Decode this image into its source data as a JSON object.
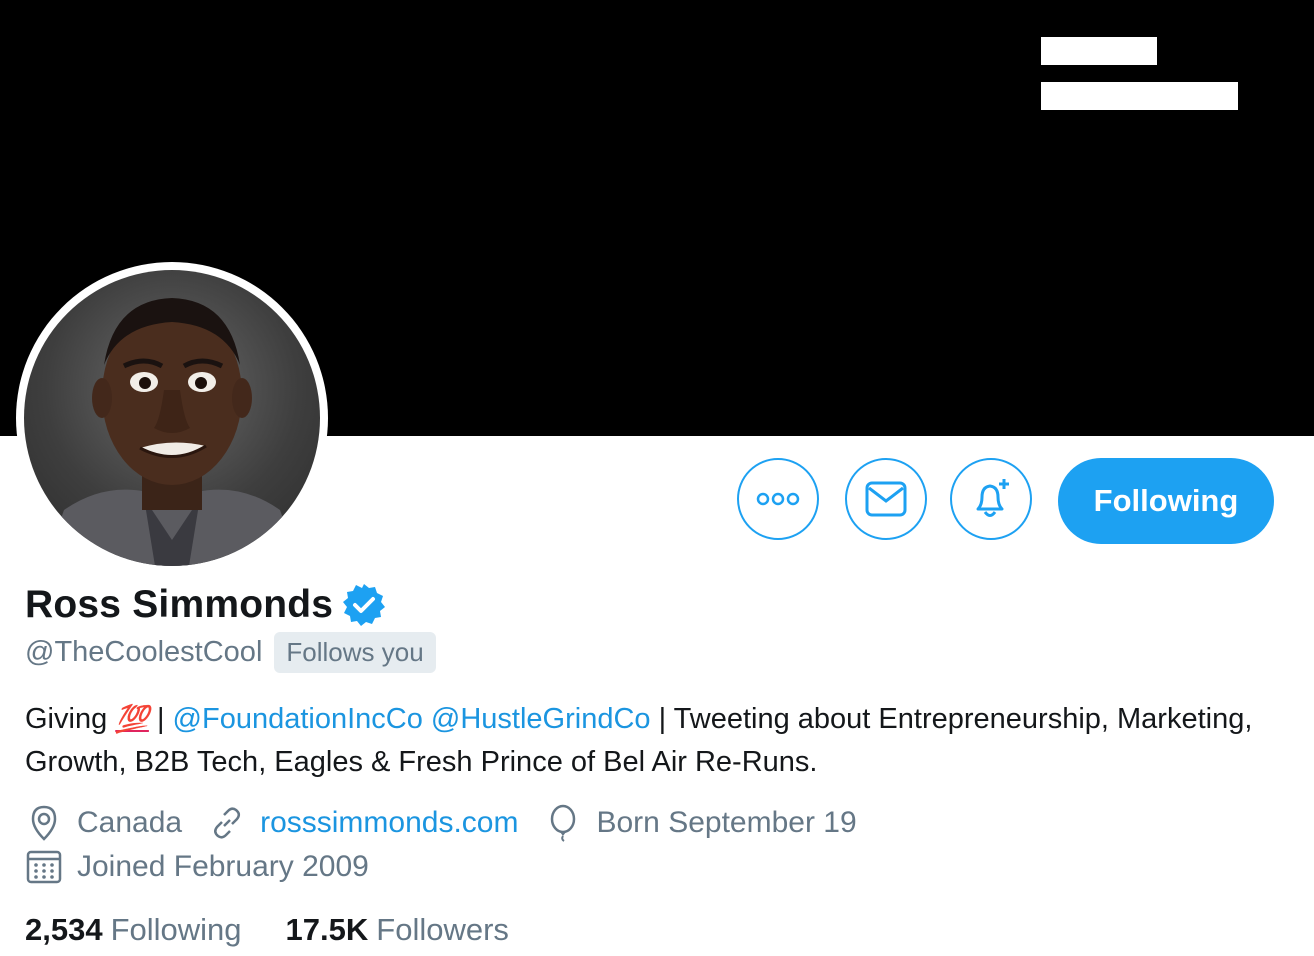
{
  "profile": {
    "display_name": "Ross Simmonds",
    "handle": "@TheCoolestCool",
    "follows_you_badge": "Follows you",
    "verified": true
  },
  "actions": {
    "more_icon": "more-icon",
    "message_icon": "mail-icon",
    "notify_icon": "bell-plus-icon",
    "following_label": "Following"
  },
  "bio": {
    "prefix": "Giving ",
    "emoji": "💯",
    "sep1": " | ",
    "mention1": "@FoundationIncCo",
    "space": " ",
    "mention2": "@HustleGrindCo",
    "suffix": " | Tweeting about Entrepreneurship, Marketing, Growth, B2B Tech, Eagles & Fresh Prince of Bel Air Re-Runs."
  },
  "meta": {
    "location": "Canada",
    "website": "rosssimmonds.com",
    "birthday": "Born September 19",
    "joined": "Joined February 2009"
  },
  "stats": {
    "following_count": "2,534",
    "following_label": "Following",
    "followers_count": "17.5K",
    "followers_label": "Followers"
  },
  "colors": {
    "accent": "#1da1f2",
    "link": "#1b95e0",
    "secondary_text": "#657786",
    "banner": "#000000"
  }
}
